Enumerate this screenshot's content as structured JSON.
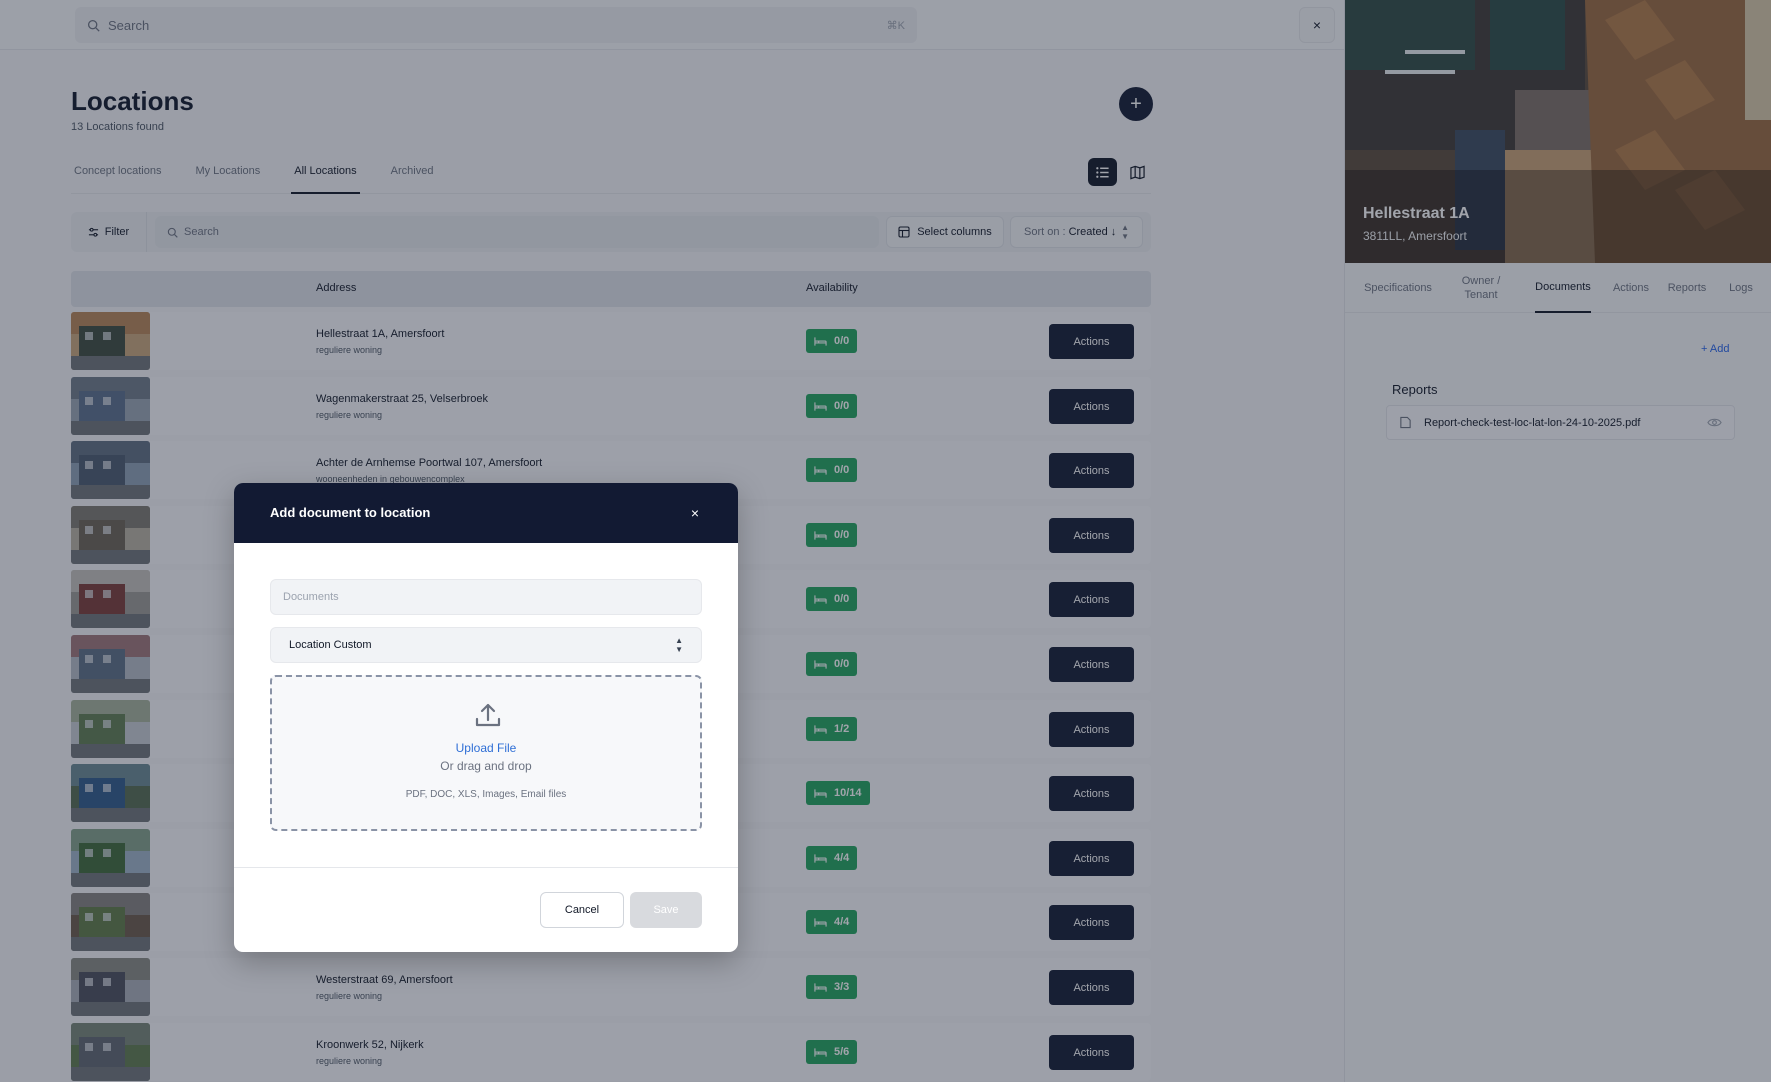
{
  "search": {
    "placeholder": "Search",
    "shortcut": "⌘K"
  },
  "page": {
    "title": "Locations",
    "count_text": "13 Locations found",
    "add_button": "+",
    "tabs": [
      "Concept locations",
      "My Locations",
      "All Locations",
      "Archived"
    ],
    "active_tab": "All Locations"
  },
  "toolbar": {
    "filter_label": "Filter",
    "search_placeholder": "Search",
    "select_columns_label": "Select columns",
    "sort_prefix": "Sort on :",
    "sort_value": "Created ↓"
  },
  "table": {
    "headers": {
      "address": "Address",
      "availability": "Availability"
    },
    "rows": [
      {
        "address": "Hellestraat 1A, Amersfoort",
        "type": "reguliere woning",
        "availability": "0/0",
        "action": "Actions"
      },
      {
        "address": "Wagenmakerstraat 25, Velserbroek",
        "type": "reguliere woning",
        "availability": "0/0",
        "action": "Actions"
      },
      {
        "address": "Achter de Arnhemse Poortwal 107, Amersfoort",
        "type": "wooneenheden in gebouwencomplex",
        "availability": "0/0",
        "action": "Actions"
      },
      {
        "address": "",
        "type": "",
        "availability": "0/0",
        "action": "Actions"
      },
      {
        "address": "",
        "type": "",
        "availability": "0/0",
        "action": "Actions"
      },
      {
        "address": "",
        "type": "",
        "availability": "0/0",
        "action": "Actions"
      },
      {
        "address": "",
        "type": "",
        "availability": "1/2",
        "action": "Actions"
      },
      {
        "address": "",
        "type": "",
        "availability": "10/14",
        "action": "Actions"
      },
      {
        "address": "",
        "type": "",
        "availability": "4/4",
        "action": "Actions"
      },
      {
        "address": "",
        "type": "",
        "availability": "4/4",
        "action": "Actions"
      },
      {
        "address": "Westerstraat 69, Amersfoort",
        "type": "reguliere woning",
        "availability": "3/3",
        "action": "Actions"
      },
      {
        "address": "Kroonwerk 52, Nijkerk",
        "type": "reguliere woning",
        "availability": "5/6",
        "action": "Actions"
      }
    ]
  },
  "panel": {
    "close": "×",
    "title": "Hellestraat 1A",
    "subtitle": "3811LL, Amersfoort",
    "tabs": [
      "Specifications",
      "Owner / Tenant",
      "Documents",
      "Actions",
      "Reports",
      "Logs"
    ],
    "active_tab": "Documents",
    "add_link": "+ Add",
    "section_label": "Reports",
    "files": [
      {
        "name": "Report-check-test-loc-lat-lon-24-10-2025.pdf"
      }
    ]
  },
  "modal": {
    "title": "Add document to location",
    "close": "×",
    "documents_placeholder": "Documents",
    "documents_value": "",
    "category_value": "Location Custom",
    "upload_label": "Upload File",
    "drag_label": "Or drag and drop",
    "file_types": "PDF, DOC, XLS, Images, Email files",
    "cancel_label": "Cancel",
    "save_label": "Save"
  },
  "colors": {
    "primary_dark": "#121a33",
    "availability_green": "#22a45d",
    "link_blue": "#2f6fd6",
    "overlay": "rgba(31,38,56,0.42)"
  }
}
